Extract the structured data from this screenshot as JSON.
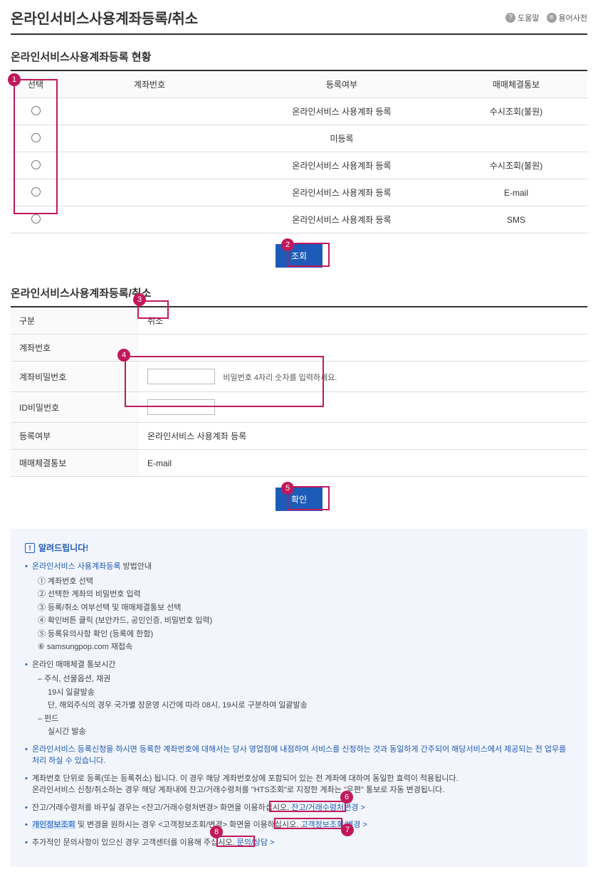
{
  "header": {
    "title": "온라인서비스사용계좌등록/취소",
    "help": "도움말",
    "glossary": "용어사전"
  },
  "status": {
    "title": "온라인서비스사용계좌등록 현황",
    "cols": [
      "선택",
      "계좌번호",
      "등록여부",
      "매매체결통보"
    ],
    "rows": [
      {
        "acct": "",
        "reg": "온라인서비스 사용계좌 등록",
        "notice": "수시조회(불원)"
      },
      {
        "acct": "",
        "reg": "미등록",
        "notice": ""
      },
      {
        "acct": "",
        "reg": "온라인서비스 사용계좌 등록",
        "notice": "수시조회(불원)"
      },
      {
        "acct": "",
        "reg": "온라인서비스 사용계좌 등록",
        "notice": "E-mail"
      },
      {
        "acct": "",
        "reg": "온라인서비스 사용계좌 등록",
        "notice": "SMS"
      }
    ],
    "queryBtn": "조회"
  },
  "form": {
    "title": "온라인서비스사용계좌등록/취소",
    "rows": {
      "type_label": "구분",
      "type_value": "취소",
      "acct_label": "계좌번호",
      "acct_value": "",
      "acctpw_label": "계좌비밀번호",
      "acctpw_hint": "비밀번호 4자리 숫자를 입력하세요.",
      "idpw_label": "ID비밀번호",
      "reg_label": "등록여부",
      "reg_value": "온라인서비스 사용계좌 등록",
      "notice_label": "매매체결통보",
      "notice_value": "E-mail"
    },
    "confirmBtn": "확인"
  },
  "notice": {
    "title": "알려드립니다!",
    "guide_title": "온라인서비스 사용계좌등록",
    "guide_suffix": " 방법안내",
    "guide_steps": [
      "① 계좌번호 선택",
      "② 선택한 계좌의 비밀번호 입력",
      "③ 등록/취소 여부선택 및 매매체결통보 선택",
      "④ 확인버튼 클릭 (보안카드, 공인인증, 비밀번호 입력)",
      "⑤ 등록유의사항 확인 (등록에 한함)",
      "⑥ samsungpop.com 재접속"
    ],
    "time_title": "온라인 매매체결 통보시간",
    "time_stock_label": "–  주식, 선물옵션, 채권",
    "time_stock_1": "19시 일괄발송",
    "time_stock_2": "단, 해외주식의 경우 국가별 장운영 시간에 따라 08시, 19시로 구분하여 일괄발송",
    "time_fund_label": "–  펀드",
    "time_fund_1": "실시간 발송",
    "bullet3": "온라인서비스 등록신청을 하시면 등록한 계좌번호에 대해서는 당사 영업점에 내점하여 서비스를 신청하는 것과 동일하게 간주되어 해당서비스에서 제공되는 전 업무를 처리 하실 수 있습니다.",
    "bullet4a": "계좌번호 단위로 등록(또는 등록취소) 됩니다. 이 경우 해당 계좌번호상에 포함되어 있는 전 계좌에 대하여 동일한 효력이 적용됩니다.",
    "bullet4b": "온라인서비스 신청/취소하는 경우 해당 계좌내에 잔고/거래수령처를 \"HTS조회\"로 지정한 계좌는 \"우편\" 통보로 자동 변경됩니다.",
    "bullet5_pre": "잔고/거래수령처를 바꾸실 경우는 <잔고/거래수령처변경> 화면을 이용하십시오. ",
    "bullet5_link": "잔고/거래수령처변경 >",
    "bullet6_pre_link": "개인정보조회",
    "bullet6_mid": " 및 변경을 원하시는 경우 <고객정보조회/변경> 화면을 이용하십시오. ",
    "bullet6_link": "고객정보조회/변경 >",
    "bullet7_pre": "추가적인 문의사항이 있으신 경우 고객센터를 이용해 주십시오. ",
    "bullet7_link": "문의/상담 >"
  },
  "markers": [
    "1",
    "2",
    "3",
    "4",
    "5",
    "6",
    "7",
    "8"
  ]
}
